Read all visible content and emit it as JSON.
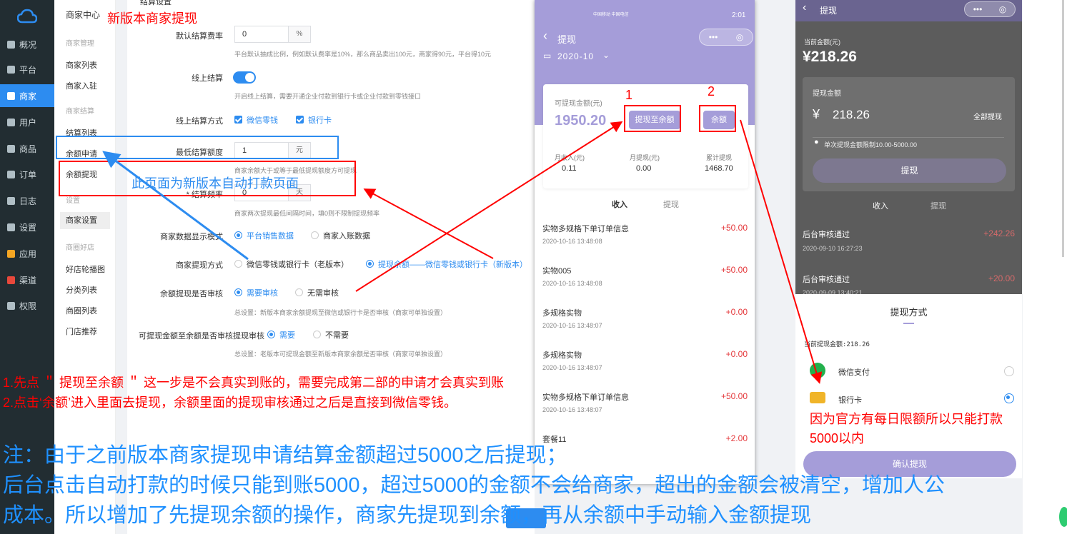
{
  "sidebar": {
    "items": [
      {
        "label": "概况",
        "icon": "dashboard-icon"
      },
      {
        "label": "平台",
        "icon": "monitor-icon"
      },
      {
        "label": "商家",
        "icon": "store-icon"
      },
      {
        "label": "用户",
        "icon": "user-icon"
      },
      {
        "label": "商品",
        "icon": "goods-icon"
      },
      {
        "label": "订单",
        "icon": "order-icon"
      },
      {
        "label": "日志",
        "icon": "log-icon"
      },
      {
        "label": "设置",
        "icon": "settings-icon"
      },
      {
        "label": "应用",
        "icon": "apps-icon"
      },
      {
        "label": "渠道",
        "icon": "channel-icon"
      },
      {
        "label": "权限",
        "icon": "lock-icon"
      }
    ],
    "active": "商家"
  },
  "subnav": {
    "title": "商家中心",
    "g1": "商家管理",
    "i1": "商家列表",
    "i2": "商家入驻",
    "g2": "商家结算",
    "i3": "结算列表",
    "i4": "余额申请",
    "i5": "余额提现",
    "g3": "设置",
    "i6": "商家设置",
    "g4": "商圈好店",
    "i7": "好店轮播图",
    "i8": "分类列表",
    "i9": "商圈列表",
    "i10": "门店推荐"
  },
  "form": {
    "section": "结算设置",
    "rate_label": "默认结算费率",
    "rate_value": "0",
    "rate_unit": "%",
    "rate_hint": "平台默认抽成比例，例如默认费率是10%，那么商品卖出100元，商家得90元，平台得10元",
    "online_label": "线上结算",
    "online_hint": "开启线上结算，需要开通企业付款到银行卡或企业付款到零钱接口",
    "method_label": "线上结算方式",
    "method_wechat": "微信零钱",
    "method_bank": "银行卡",
    "min_label": "最低结算额度",
    "min_value": "1",
    "min_unit": "元",
    "min_hint": "商家余额大于或等于最低提现额度方可提现",
    "freq_label": "* 结算频率",
    "freq_value": "0",
    "freq_unit": "天",
    "freq_hint": "商家两次提现最低间隔时间，填0则不限制提现频率",
    "display_label": "商家数据显示模式",
    "display_opt1": "平台销售数据",
    "display_opt2": "商家入账数据",
    "wd_label": "商家提现方式",
    "wd_opt1": "微信零钱或银行卡（老版本）",
    "wd_opt2": "提现余额——微信零钱或银行卡（新版本）",
    "audit_label": "余额提现是否审核",
    "audit_opt1": "需要审核",
    "audit_opt2": "无需审核",
    "audit_hint": "总设置：新版本商家余额提现至微信或银行卡是否审核（商家可单独设置）",
    "audit2_label": "可提现金额至余额是否审核提现审核",
    "audit2_opt1": "需要",
    "audit2_opt2": "不需要",
    "audit2_hint": "总设置：老版本可提现金额至新版本商家余额是否审核（商家可单独设置）"
  },
  "phone1": {
    "status_carrier": "中国移动 中国电信",
    "status_time": "2:01",
    "nav_title": "提现",
    "capsule_dots": "•••",
    "month": "2020-10",
    "avail_label": "可提现金额(元)",
    "avail_value": "1950.20",
    "to_balance_btn": "提现至余额",
    "balance_btn": "余额",
    "stats": [
      {
        "label": "月收入(元)",
        "value": "0.11"
      },
      {
        "label": "月提现(元)",
        "value": "0.00"
      },
      {
        "label": "累计提现",
        "value": "1468.70"
      }
    ],
    "tab_income": "收入",
    "tab_withdraw": "提现",
    "records": [
      {
        "title": "实物多规格下单订单信息",
        "date": "2020-10-16 13:48:08",
        "amount": "+50.00"
      },
      {
        "title": "实物005",
        "date": "2020-10-16 13:48:08",
        "amount": "+50.00"
      },
      {
        "title": "多规格实物",
        "date": "2020-10-16 13:48:07",
        "amount": "+0.00"
      },
      {
        "title": "多规格实物",
        "date": "2020-10-16 13:48:07",
        "amount": "+0.00"
      },
      {
        "title": "实物多规格下单订单信息",
        "date": "2020-10-16 13:48:07",
        "amount": "+50.00"
      },
      {
        "title": "套餐11",
        "date": "",
        "amount": "+2.00"
      }
    ]
  },
  "phone2": {
    "nav_title": "提现",
    "balance_label": "当前金额(元)",
    "balance_value": "¥218.26",
    "wd_amount_label": "提现金额",
    "currency": "¥",
    "wd_amount_value": "218.26",
    "all_btn": "全部提现",
    "limit_hint": "单次提现金额限制10.00-5000.00",
    "wd_btn": "提现",
    "tab_income": "收入",
    "tab_withdraw": "提现",
    "records": [
      {
        "title": "后台审核通过",
        "date": "2020-09-10 16:27:23",
        "amount": "+242.26"
      },
      {
        "title": "后台审核通过",
        "date": "2020-09-09 13:40:21",
        "amount": "+20.00"
      }
    ],
    "sheet_title": "提现方式",
    "sheet_current": "当前提现金额:218.26",
    "opt_wechat": "微信支付",
    "opt_bank": "银行卡",
    "confirm_btn": "确认提现"
  },
  "annotations": {
    "new_version": "新版本商家提现",
    "auto_pay_page": "此页面为新版本自动打款页面",
    "num1": "1",
    "num2": "2",
    "step1": "1.先点 ＂ 提现至余额 ＂ 这一步是不会真实到账的，需要完成第二部的申请才会真实到账",
    "step2": "2.点击‘余额’进入里面去提现，余额里面的提现审核通过之后是直接到微信零钱。",
    "limit1": "因为官方有每日限额所以只能打款",
    "limit2": "5000以内",
    "note1": "注：由于之前版本商家提现申请结算金额超过5000之后提现；",
    "note2": "后台点击自动打款的时候只能到账5000，超过5000的金额不会给商家，超出的金额会被清空，增加人公",
    "note3": "成本。所以增加了先提现余额的操作，商家先提现到余额，再从余额中手动输入金额提现"
  },
  "colors": {
    "sidebar": "#222d32",
    "accent": "#2d8cf0",
    "phone_purple": "#a59dd9",
    "annotation_red": "#ff0000",
    "annotation_blue": "#1e90ff"
  }
}
